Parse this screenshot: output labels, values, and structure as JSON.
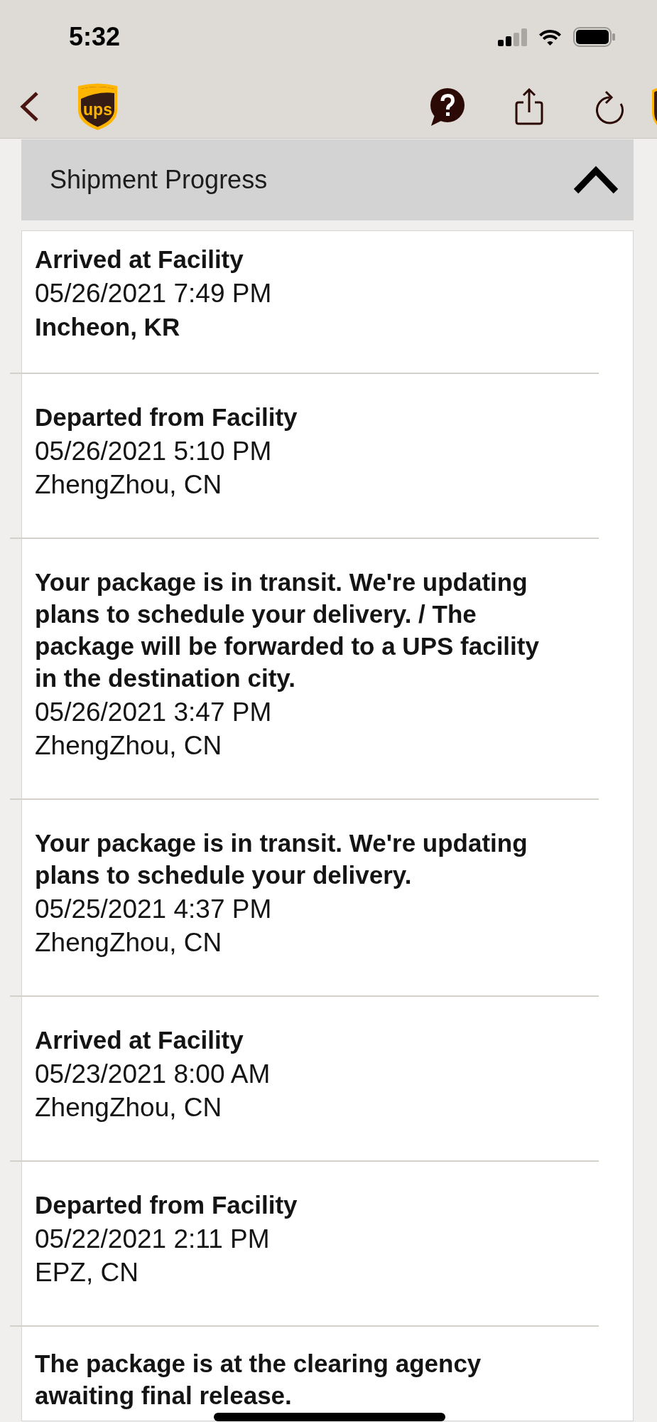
{
  "status_bar": {
    "time": "5:32"
  },
  "nav_bar": {
    "logo_text": "ups"
  },
  "section": {
    "title": "Shipment Progress",
    "expanded": true
  },
  "events": [
    {
      "status": "Arrived at Facility",
      "datetime": "05/26/2021 7:49 PM",
      "location": "Incheon, KR",
      "current": true
    },
    {
      "status": "Departed from Facility",
      "datetime": "05/26/2021 5:10 PM",
      "location": "ZhengZhou, CN",
      "current": false
    },
    {
      "status": "Your package is in transit. We're updating plans to schedule your delivery. / The package will be forwarded to a UPS facility in the destination city.",
      "datetime": "05/26/2021 3:47 PM",
      "location": "ZhengZhou, CN",
      "current": false
    },
    {
      "status": "Your package is in transit. We're updating plans to schedule your delivery.",
      "datetime": "05/25/2021 4:37 PM",
      "location": "ZhengZhou, CN",
      "current": false
    },
    {
      "status": "Arrived at Facility",
      "datetime": "05/23/2021 8:00 AM",
      "location": "ZhengZhou, CN",
      "current": false
    },
    {
      "status": "Departed from Facility",
      "datetime": "05/22/2021 2:11 PM",
      "location": "EPZ, CN",
      "current": false
    },
    {
      "status": "The package is at the clearing agency awaiting final release."
    }
  ]
}
